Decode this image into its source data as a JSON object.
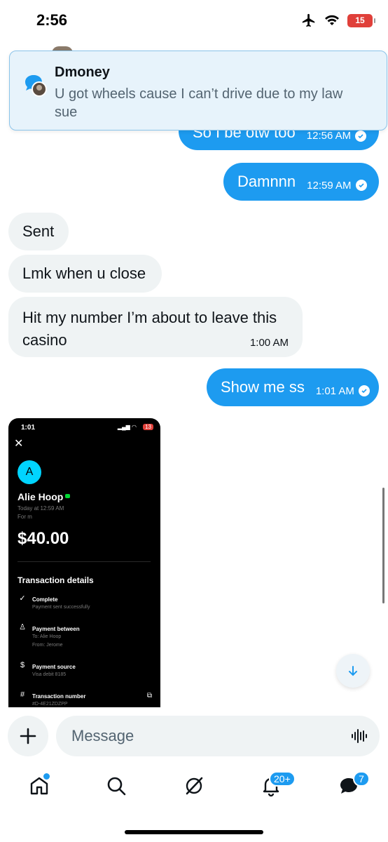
{
  "status_bar": {
    "time": "2:56",
    "battery": "15"
  },
  "notification": {
    "sender": "Dmoney",
    "message": "U got wheels cause I can’t drive due to my law sue"
  },
  "messages": [
    {
      "text": "So I be otw too",
      "time": "12:56 AM",
      "direction": "outgoing"
    },
    {
      "text": "Damnnn",
      "time": "12:59 AM",
      "direction": "outgoing"
    },
    {
      "text": "Sent",
      "direction": "incoming"
    },
    {
      "text": "Lmk when u close",
      "direction": "incoming"
    },
    {
      "text": "Hit my number I’m about to leave this casino",
      "time": "1:00 AM",
      "direction": "incoming"
    },
    {
      "text": "Show me ss",
      "time": "1:01 AM",
      "direction": "outgoing"
    }
  ],
  "screenshot": {
    "time": "1:01",
    "battery": "13",
    "avatar_letter": "A",
    "name": "Alie Hoop",
    "date": "Today at 12:59 AM",
    "for": "For m",
    "amount": "$40.00",
    "section": "Transaction details",
    "status_label": "Complete",
    "status_sub": "Payment sent successfully",
    "between_label": "Payment between",
    "to": "To: Alie Hoop",
    "from": "From: Jerome",
    "source_label": "Payment source",
    "source_sub": "Visa debit 8185",
    "txn_label": "Transaction number",
    "txn_sub": "#D-4E21ZDZPP"
  },
  "composer": {
    "placeholder": "Message"
  },
  "tab_bar": {
    "notifications_badge": "20+",
    "messages_badge": "7"
  },
  "colors": {
    "accent": "#1d9bf0",
    "incoming_bubble": "#eff3f4",
    "banner_bg": "#e7f3fb"
  }
}
